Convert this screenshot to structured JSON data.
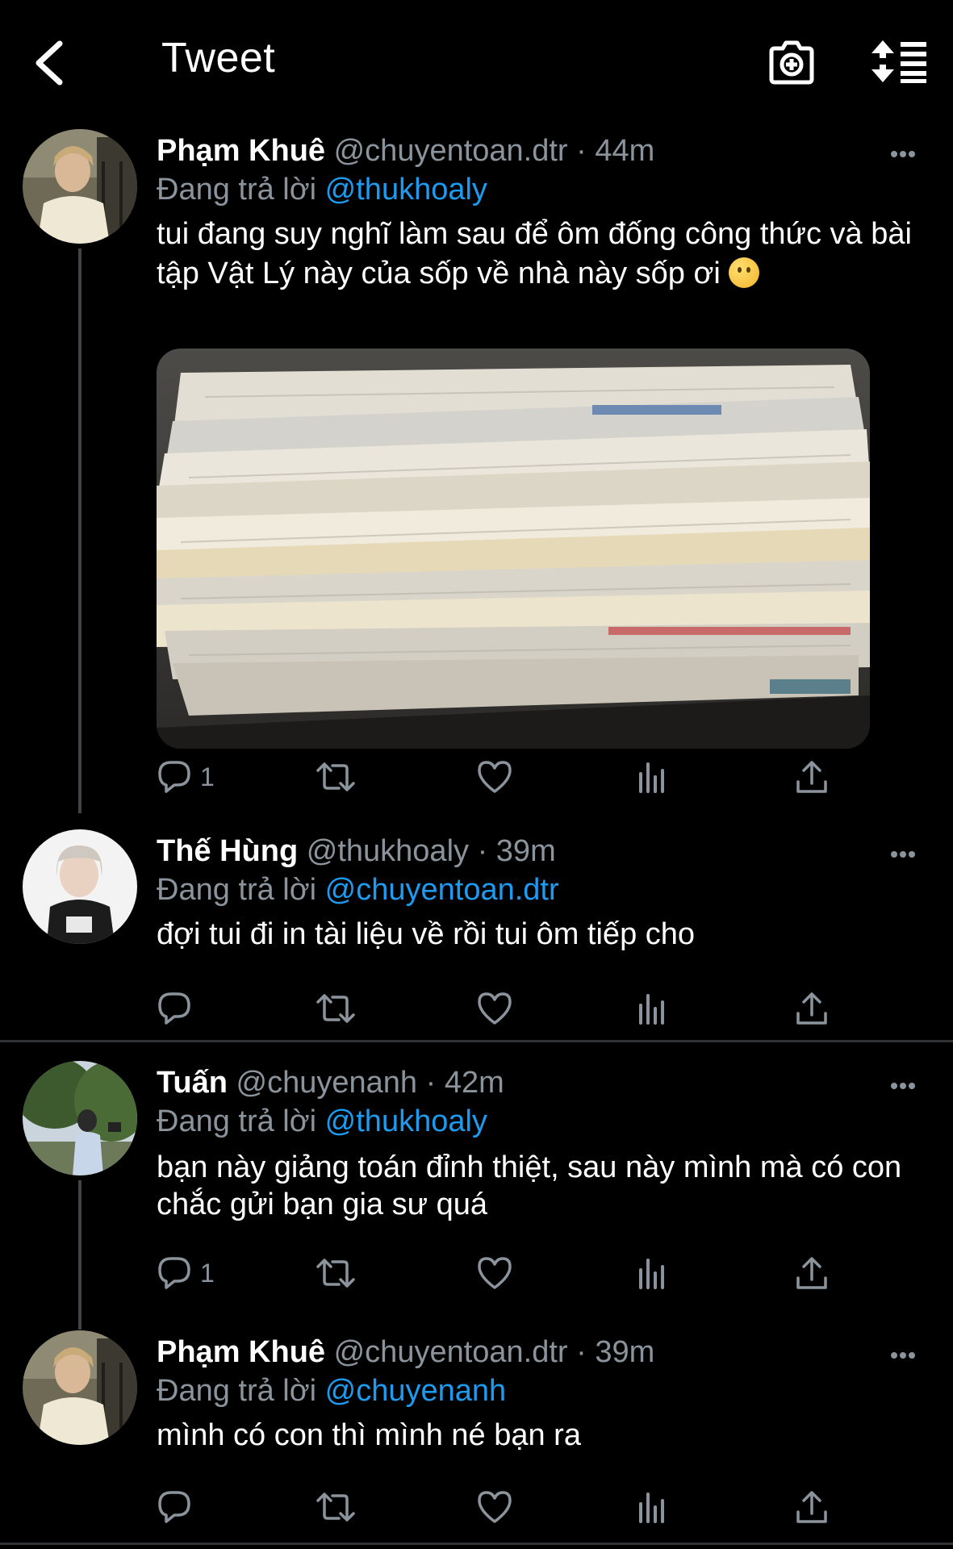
{
  "header": {
    "title": "Tweet"
  },
  "tweets": [
    {
      "name": "Phạm Khuê",
      "handle": "@chuyentoan.dtr",
      "sep": "·",
      "time": "44m",
      "reply_label": "Đang trả lời",
      "reply_to": "@thukhoaly",
      "text": "tui đang suy nghĩ làm sau để ôm đống công thức và bài tập Vật Lý này của sốp về nhà này sốp ơi",
      "emoji": "slightly-smiling-face",
      "reply_count": "1"
    },
    {
      "name": "Thế Hùng",
      "handle": "@thukhoaly",
      "sep": "·",
      "time": "39m",
      "reply_label": "Đang trả lời",
      "reply_to": "@chuyentoan.dtr",
      "text": "đợi tui đi in tài liệu về rồi tui ôm tiếp cho",
      "reply_count": ""
    },
    {
      "name": "Tuấn",
      "handle": "@chuyenanh",
      "sep": "·",
      "time": "42m",
      "reply_label": "Đang trả lời",
      "reply_to": "@thukhoaly",
      "text": "bạn này giảng toán đỉnh thiệt, sau này mình mà có con chắc gửi bạn gia sư quá",
      "reply_count": "1"
    },
    {
      "name": "Phạm Khuê",
      "handle": "@chuyentoan.dtr",
      "sep": "·",
      "time": "39m",
      "reply_label": "Đang trả lời",
      "reply_to": "@chuyenanh",
      "text": "mình có con thì mình né bạn ra",
      "reply_count": ""
    }
  ],
  "icons": {
    "back": "chevron-left-icon",
    "camera": "camera-plus-icon",
    "sort": "sort-icon",
    "reply": "reply-icon",
    "retweet": "retweet-icon",
    "like": "heart-icon",
    "analytics": "analytics-icon",
    "share": "share-icon",
    "more": "more-icon"
  },
  "colors": {
    "background": "#000000",
    "accent": "#1d9bf0",
    "muted": "#8b949c",
    "divider": "#2f3336"
  }
}
